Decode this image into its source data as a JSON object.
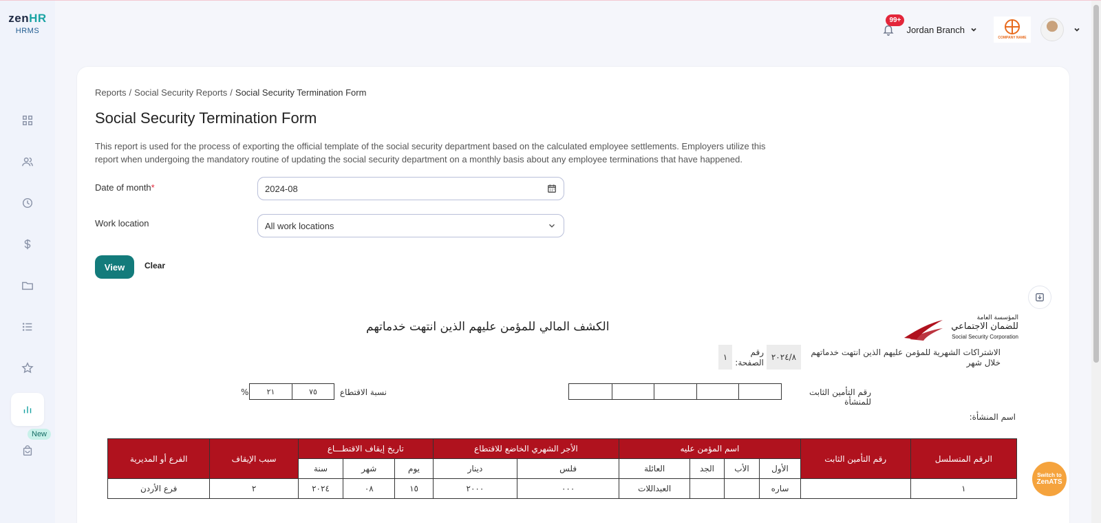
{
  "brand": {
    "name_main": "zen",
    "name_accent": "HR",
    "product": "HRMS"
  },
  "sidebar": {
    "items": [
      {
        "icon": "dashboard-icon"
      },
      {
        "icon": "users-icon"
      },
      {
        "icon": "clock-icon"
      },
      {
        "icon": "dollar-icon"
      },
      {
        "icon": "folder-icon"
      },
      {
        "icon": "list-icon"
      },
      {
        "icon": "star-icon"
      },
      {
        "icon": "reports-icon",
        "active": true
      },
      {
        "icon": "bag-icon"
      }
    ],
    "new_badge": "New"
  },
  "topbar": {
    "notifications": "99+",
    "branch": "Jordan Branch",
    "company_logo_text": "COMPANY NAME"
  },
  "breadcrumb": [
    "Reports",
    "Social Security Reports",
    "Social Security Termination Form"
  ],
  "page": {
    "title": "Social Security Termination Form",
    "description": "This report is used for the process of exporting the official template of the social security department based on the calculated employee settlements. Employers utilize this report when undergoing the mandatory routine of updating the social security department on a monthly basis about any employee terminations that have happened."
  },
  "form": {
    "date_label": "Date of month",
    "date_required": "*",
    "date_value": "2024-08",
    "location_label": "Work location",
    "location_value": "All work locations",
    "view_label": "View",
    "clear_label": "Clear"
  },
  "report": {
    "title": "الكشف المالي للمؤمن عليهم الذين انتهت خدماتهم",
    "logo_arabic_line1": "المؤسسة العامة",
    "logo_arabic_line2": "للضمان الاجتماعي",
    "logo_english": "Social Security Corporation",
    "subscriptions_label": "الاشتراكات الشهرية للمؤمن عليهم الذين انتهت خدماتهم خلال شهر",
    "month_value": "٢٠٢٤/٨",
    "page_label": "رقم الصفحة:",
    "page_value": "١",
    "fixed_insurance_label": "رقم التأمين الثابت للمنشأة",
    "deduction_label": "نسبة الاقتطاع",
    "deduction_values": [
      "٧٥",
      "٢١"
    ],
    "percent_sign": "%",
    "establishment_label": "اسم المنشأة:"
  },
  "table": {
    "headers": {
      "serial": "الرقم المتسلسل",
      "fixed_no": "رقم التأمين الثابت",
      "insured_name": "اسم المؤمن عليه",
      "wage": "الأجر الشهري الخاضع للاقتطاع",
      "stop_date": "تاريخ إيقاف الاقتطـــاع",
      "stop_reason": "سبب الإيقاف",
      "branch": "الفرع أو المديرية"
    },
    "sub_headers": {
      "first": "الأول",
      "father": "الأب",
      "grandfather": "الجد",
      "family": "العائلة",
      "fils": "فلس",
      "dinar": "دينار",
      "day": "يوم",
      "month": "شهر",
      "year": "سنة"
    },
    "rows": [
      {
        "serial": "١",
        "fixed_no": "",
        "first": "ساره",
        "father": "",
        "grandfather": "",
        "family": "العبداللات",
        "fils": "٠٠٠",
        "dinar": "٢٠٠٠",
        "day": "١٥",
        "month": "٠٨",
        "year": "٢٠٢٤",
        "stop_reason": "٢",
        "branch": "فرع الأردن"
      }
    ]
  },
  "switch_ats": {
    "line1": "Switch to",
    "line2": "ZenATS"
  }
}
